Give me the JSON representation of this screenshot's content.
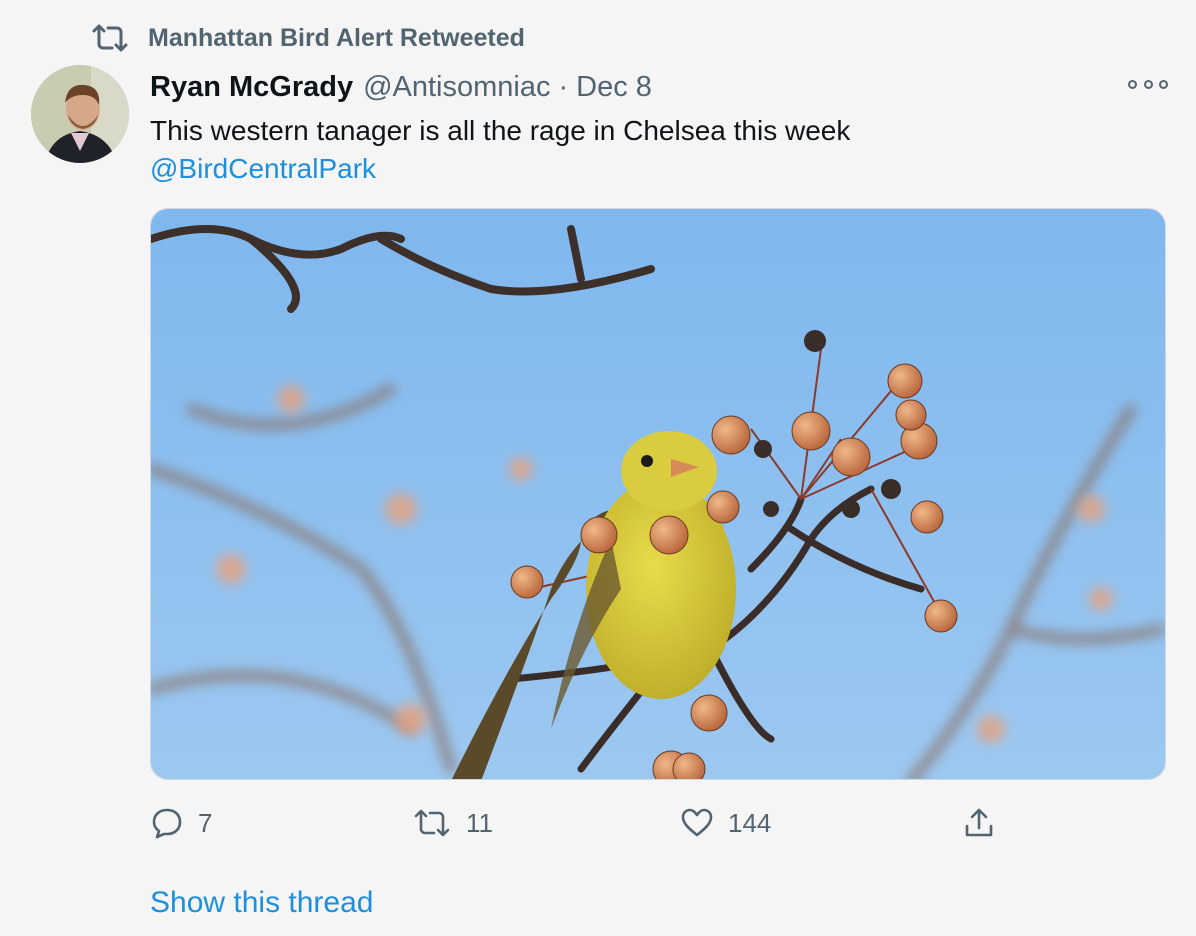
{
  "retweet_banner": {
    "text": "Manhattan Bird Alert Retweeted",
    "icon": "retweet-icon"
  },
  "tweet": {
    "author_name": "Ryan McGrady",
    "author_handle": "@Antisomniac",
    "separator": "·",
    "date": "Dec 8",
    "text": "This western tanager is all the rage in Chelsea this week",
    "mention": "@BirdCentralPark",
    "media_alt": "Yellow western tanager perched among small orange berries against a blue sky"
  },
  "actions": {
    "reply_count": "7",
    "retweet_count": "11",
    "like_count": "144"
  },
  "show_thread": "Show this thread",
  "colors": {
    "accent": "#1d8fdb",
    "muted": "#536471",
    "background": "#f5f5f5"
  }
}
